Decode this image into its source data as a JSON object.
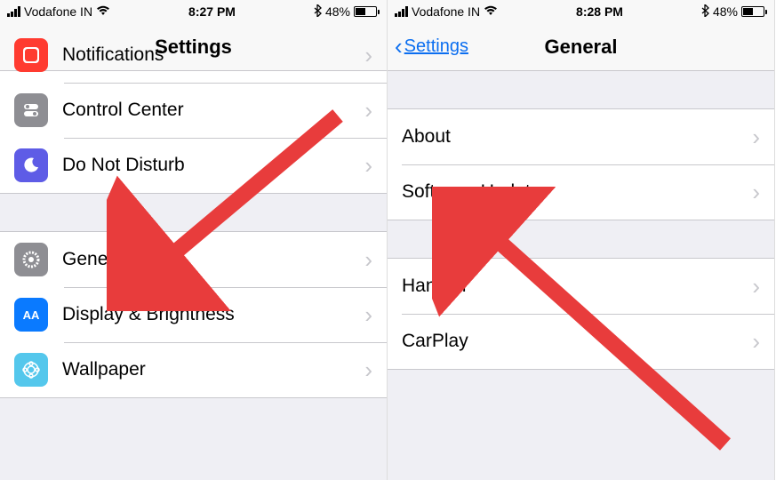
{
  "left": {
    "status": {
      "carrier": "Vodafone IN",
      "time": "8:27 PM",
      "battery": "48%"
    },
    "nav": {
      "title": "Settings"
    },
    "group1": [
      {
        "label": "Notifications",
        "icon": "notifications-icon",
        "iconClass": "ic-notif"
      },
      {
        "label": "Control Center",
        "icon": "control-center-icon",
        "iconClass": "ic-cc"
      },
      {
        "label": "Do Not Disturb",
        "icon": "dnd-icon",
        "iconClass": "ic-dnd"
      }
    ],
    "group2": [
      {
        "label": "General",
        "icon": "gear-icon",
        "iconClass": "ic-gen"
      },
      {
        "label": "Display & Brightness",
        "icon": "display-icon",
        "iconClass": "ic-disp"
      },
      {
        "label": "Wallpaper",
        "icon": "wallpaper-icon",
        "iconClass": "ic-wall"
      }
    ]
  },
  "right": {
    "status": {
      "carrier": "Vodafone IN",
      "time": "8:28 PM",
      "battery": "48%"
    },
    "nav": {
      "title": "General",
      "back": "Settings"
    },
    "group1": [
      {
        "label": "About"
      },
      {
        "label": "Software Update"
      }
    ],
    "group2": [
      {
        "label": "Handoff"
      },
      {
        "label": "CarPlay"
      }
    ]
  }
}
